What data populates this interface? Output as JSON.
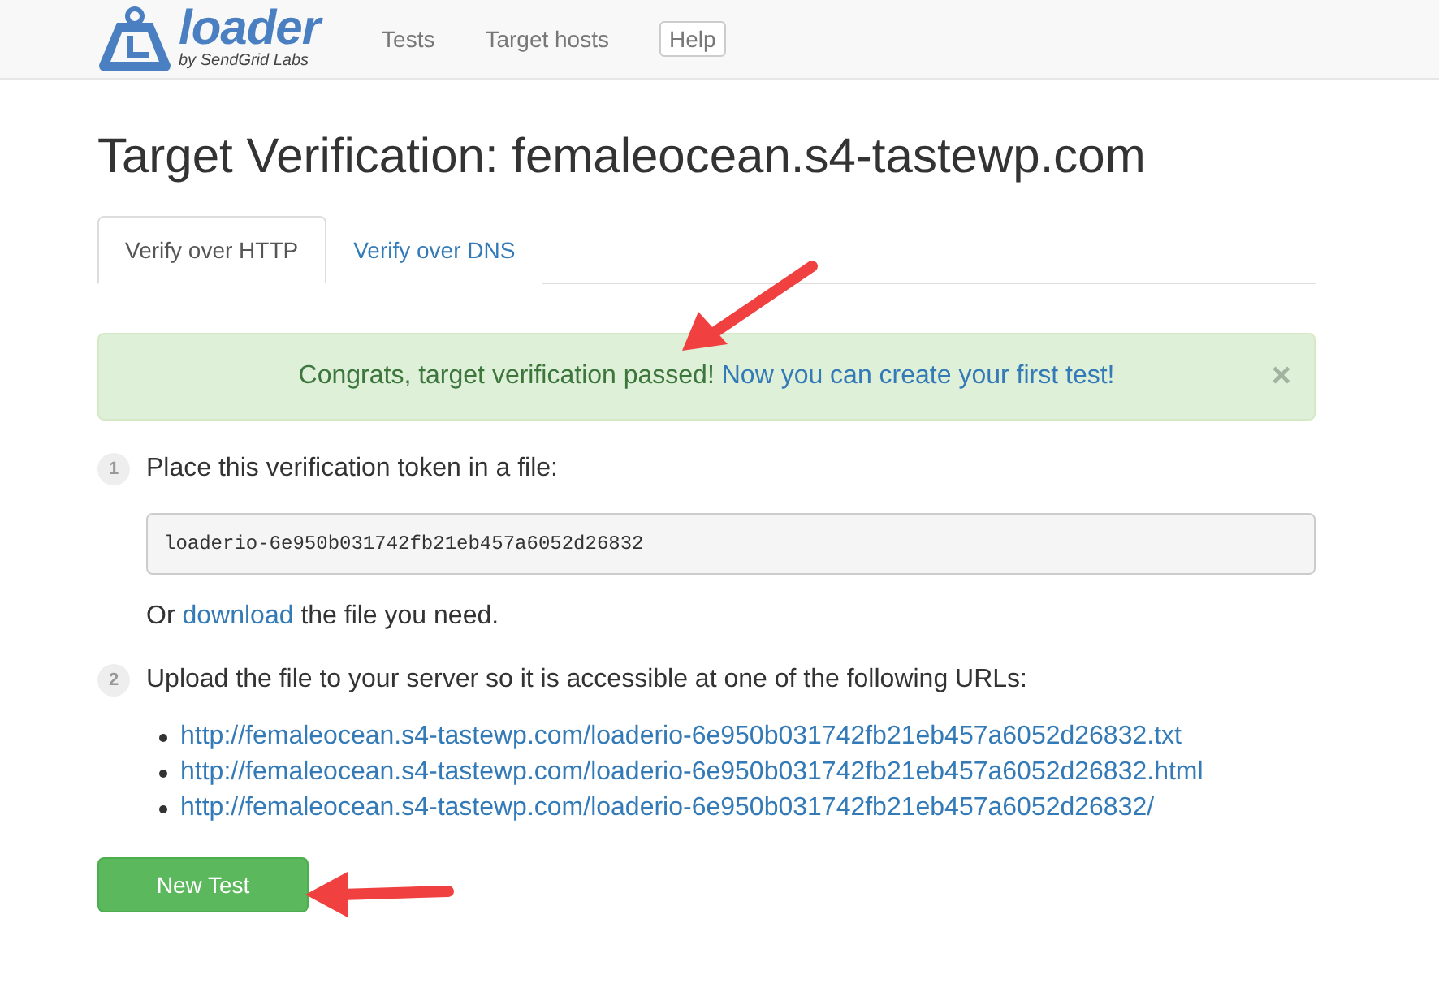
{
  "brand": {
    "name": "loader",
    "tagline": "by SendGrid Labs"
  },
  "nav": [
    {
      "label": "Tests",
      "kind": "link"
    },
    {
      "label": "Target hosts",
      "kind": "link"
    },
    {
      "label": "Help",
      "kind": "button"
    }
  ],
  "title": "Target Verification: femaleocean.s4-tastewp.com",
  "tabs": [
    {
      "label": "Verify over HTTP",
      "selected": true
    },
    {
      "label": "Verify over DNS",
      "selected": false
    }
  ],
  "alert": {
    "message": "Congrats, target verification passed!",
    "link": "Now you can create your first test!",
    "close": "×"
  },
  "steps": [
    {
      "number": "1",
      "text": "Place this verification token in a file:",
      "token": "loaderio-6e950b031742fb21eb457a6052d26832",
      "note": {
        "before": "Or",
        "link": "download",
        "after": "the file you need."
      }
    },
    {
      "number": "2",
      "text": "Upload the file to your server so it is accessible at one of the following URLs:",
      "urls": [
        "http://femaleocean.s4-tastewp.com/loaderio-6e950b031742fb21eb457a6052d26832.txt",
        "http://femaleocean.s4-tastewp.com/loaderio-6e950b031742fb21eb457a6052d26832.html",
        "http://femaleocean.s4-tastewp.com/loaderio-6e950b031742fb21eb457a6052d26832/"
      ]
    }
  ],
  "button": "New Test"
}
